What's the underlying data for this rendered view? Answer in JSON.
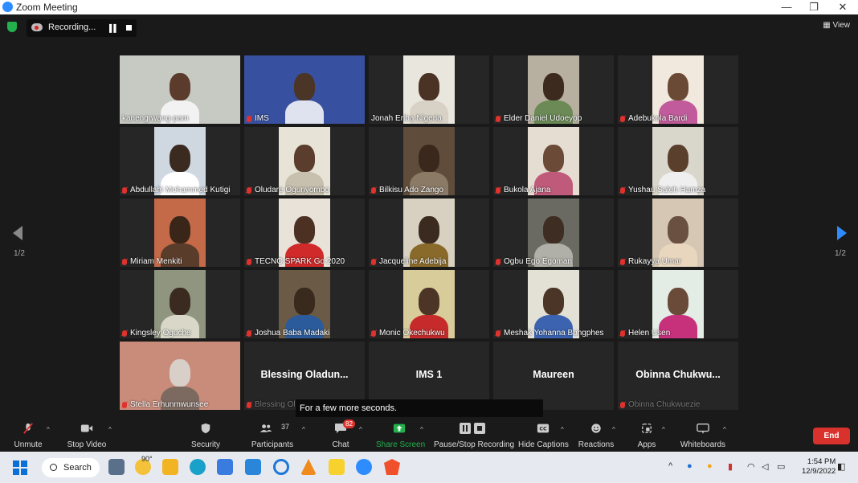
{
  "window": {
    "title": "Zoom Meeting",
    "minimize": "—",
    "restore": "❐",
    "close": "✕"
  },
  "recording": {
    "label": "Recording..."
  },
  "view_label": "View",
  "tiles": [
    {
      "name": "kanengrwang-pam",
      "muted": false,
      "active": true
    },
    {
      "name": "IMS",
      "muted": true
    },
    {
      "name": "Jonah Eriba Nigeria",
      "muted": false
    },
    {
      "name": "Elder Daniel Udoeyop",
      "muted": true
    },
    {
      "name": "Adebukola Bardi",
      "muted": true
    },
    {
      "name": "Abdullahi Mohammed Kutigi",
      "muted": true
    },
    {
      "name": "Oludare Ogunyombo",
      "muted": true
    },
    {
      "name": "Bilkisu Ado Zango",
      "muted": true
    },
    {
      "name": "Bukola Ajana",
      "muted": true
    },
    {
      "name": "Yushau Saleh Hamza",
      "muted": true
    },
    {
      "name": "Miriam Menkiti",
      "muted": true
    },
    {
      "name": "TECNO SPARK Go 2020",
      "muted": true
    },
    {
      "name": "Jacqueline Adebija",
      "muted": true
    },
    {
      "name": "Ogbu Ego Egoman",
      "muted": true
    },
    {
      "name": "Rukayya Umar",
      "muted": true
    },
    {
      "name": "Kingsley Oguche",
      "muted": true
    },
    {
      "name": "Joshua Baba Madaki",
      "muted": true
    },
    {
      "name": "Monic Okechukwu",
      "muted": true
    },
    {
      "name": "Meshak Yohanna Bongphes",
      "muted": true
    },
    {
      "name": "Helen Usen",
      "muted": true
    },
    {
      "name": "Stella Erhunmwunsee",
      "muted": true
    },
    {
      "name": "Blessing Oladunwo",
      "title": "Blessing  Oladun...",
      "muted": true
    },
    {
      "name": "IMS 1",
      "title": "IMS 1",
      "muted": true
    },
    {
      "name": "Maureen",
      "title": "Maureen",
      "muted": true
    },
    {
      "name": "Obinna Chukwuezie",
      "title": "Obinna  Chukwu...",
      "muted": true
    }
  ],
  "pager": {
    "left": "1/2",
    "right": "1/2"
  },
  "toast": "For a few more seconds.",
  "toolbar": {
    "unmute": "Unmute",
    "stop_video": "Stop Video",
    "security": "Security",
    "participants": "Participants",
    "participants_count": "37",
    "chat": "Chat",
    "chat_badge": "82",
    "share_screen": "Share Screen",
    "pause_stop": "Pause/Stop Recording",
    "hide_captions": "Hide Captions",
    "reactions": "Reactions",
    "apps": "Apps",
    "whiteboards": "Whiteboards",
    "end": "End"
  },
  "taskbar": {
    "search": "Search",
    "weather": "90°",
    "time": "1:54 PM",
    "date": "12/9/2022"
  },
  "colors": {
    "accent": "#2d8cff",
    "end": "#d9312b",
    "active_speaker": "#e6e23a",
    "share": "#23b14d"
  }
}
